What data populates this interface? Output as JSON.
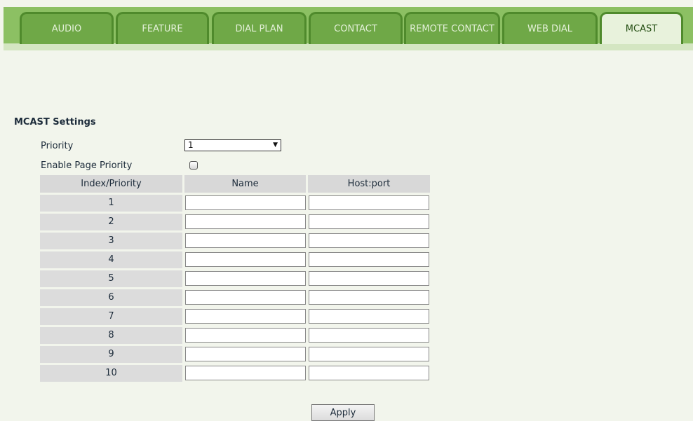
{
  "tabs": [
    "AUDIO",
    "FEATURE",
    "DIAL PLAN",
    "CONTACT",
    "REMOTE CONTACT",
    "WEB DIAL",
    "MCAST"
  ],
  "active_tab": "MCAST",
  "section_title": "MCAST Settings",
  "priority": {
    "label": "Priority",
    "value": "1"
  },
  "enable_page_priority": {
    "label": "Enable Page Priority",
    "checked": false
  },
  "table": {
    "headers": [
      "Index/Priority",
      "Name",
      "Host:port"
    ],
    "rows": [
      {
        "index": "1",
        "name": "",
        "host_port": ""
      },
      {
        "index": "2",
        "name": "",
        "host_port": ""
      },
      {
        "index": "3",
        "name": "",
        "host_port": ""
      },
      {
        "index": "4",
        "name": "",
        "host_port": ""
      },
      {
        "index": "5",
        "name": "",
        "host_port": ""
      },
      {
        "index": "6",
        "name": "",
        "host_port": ""
      },
      {
        "index": "7",
        "name": "",
        "host_port": ""
      },
      {
        "index": "8",
        "name": "",
        "host_port": ""
      },
      {
        "index": "9",
        "name": "",
        "host_port": ""
      },
      {
        "index": "10",
        "name": "",
        "host_port": ""
      }
    ]
  },
  "apply_label": "Apply",
  "colors": {
    "tab_bar": "#8cc063",
    "tab": "#6fa847",
    "active_tab": "#e8f2dc",
    "background": "#f2f5ec"
  }
}
